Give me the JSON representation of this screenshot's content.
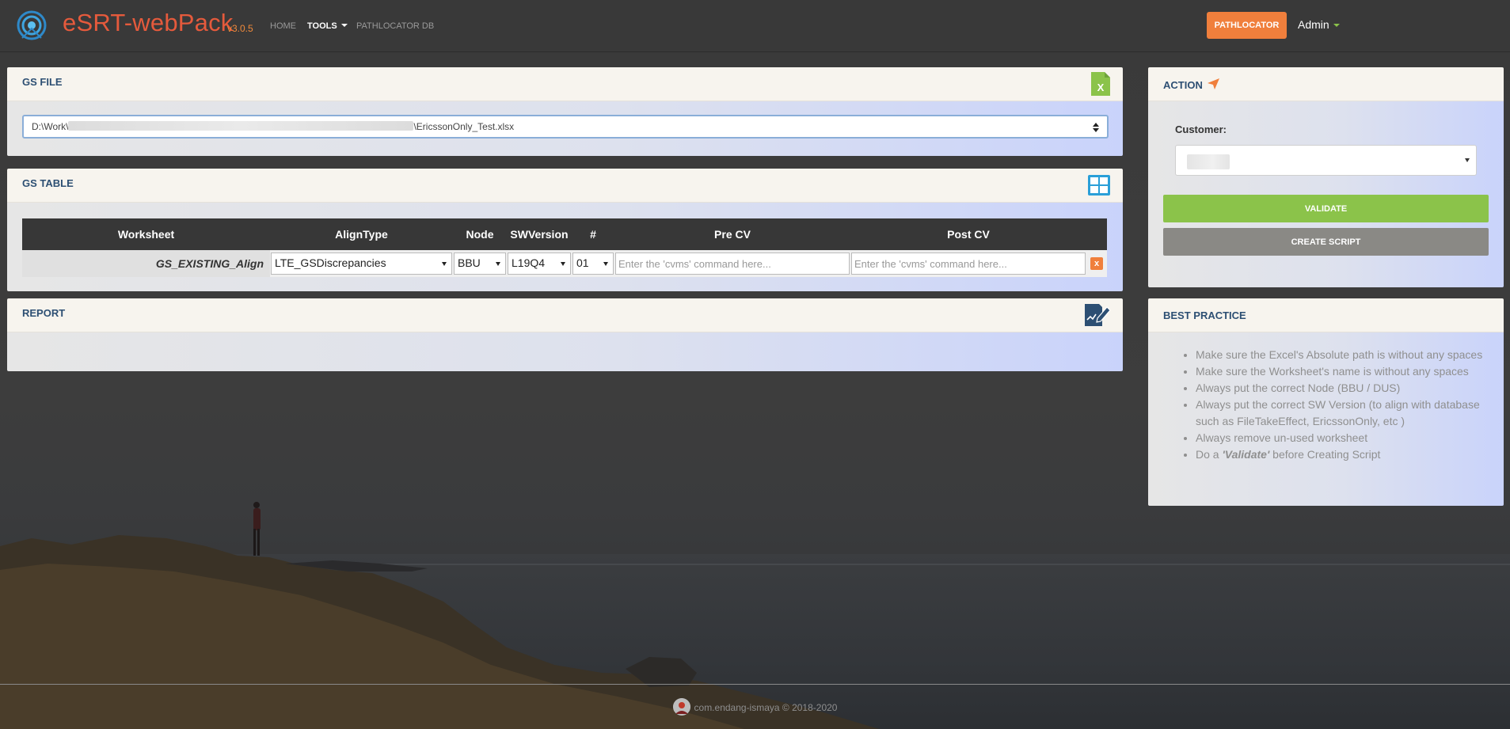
{
  "app": {
    "name": "eSRT-webPack",
    "version": "v3.0.5"
  },
  "nav": {
    "links": [
      "HOME",
      "TOOLS",
      "PATHLOCATOR DB"
    ],
    "pathlocator_button": "PATHLOCATOR",
    "user": "Admin"
  },
  "gs_file": {
    "title": "GS FILE",
    "path_prefix": "D:\\Work\\",
    "path_suffix": "\\EricssonOnly_Test.xlsx"
  },
  "gs_table": {
    "title": "GS TABLE",
    "headers": [
      "Worksheet",
      "AlignType",
      "Node",
      "SWVersion",
      "#",
      "Pre CV",
      "Post CV"
    ],
    "row": {
      "worksheet": "GS_EXISTING_Align",
      "align_type": "LTE_GSDiscrepancies",
      "node": "BBU",
      "sw_version": "L19Q4",
      "number": "01",
      "pre_cv_placeholder": "Enter the 'cvms' command here...",
      "post_cv_placeholder": "Enter the 'cvms' command here...",
      "delete_label": "x"
    }
  },
  "report": {
    "title": "REPORT"
  },
  "action": {
    "title": "ACTION",
    "customer_label": "Customer:",
    "validate_button": "VALIDATE",
    "create_script_button": "CREATE SCRIPT"
  },
  "best_practice": {
    "title": "BEST PRACTICE",
    "items": [
      "Make sure the Excel's Absolute path is without any spaces",
      "Make sure the Worksheet's name is without any spaces",
      "Always put the correct Node (BBU / DUS)",
      "Always put the correct SW Version (to align with database such as FileTakeEffect, EricssonOnly, etc )",
      "Always remove un-used worksheet"
    ],
    "last_item_prefix": "Do a ",
    "last_item_emphasis": "'Validate'",
    "last_item_suffix": " before Creating Script"
  },
  "footer": {
    "text": "com.endang-ismaya © 2018-2020"
  },
  "colors": {
    "brand": "#e55a3c",
    "accent_orange": "#f07f3c",
    "validate_green": "#8bc34a",
    "panel_title_blue": "#2d4f73",
    "table_header": "#373737"
  },
  "icons": [
    "logo-icon",
    "excel-file-icon",
    "table-grid-icon",
    "report-edit-icon",
    "paper-plane-icon",
    "sort-arrows-icon",
    "footer-avatar-icon"
  ]
}
